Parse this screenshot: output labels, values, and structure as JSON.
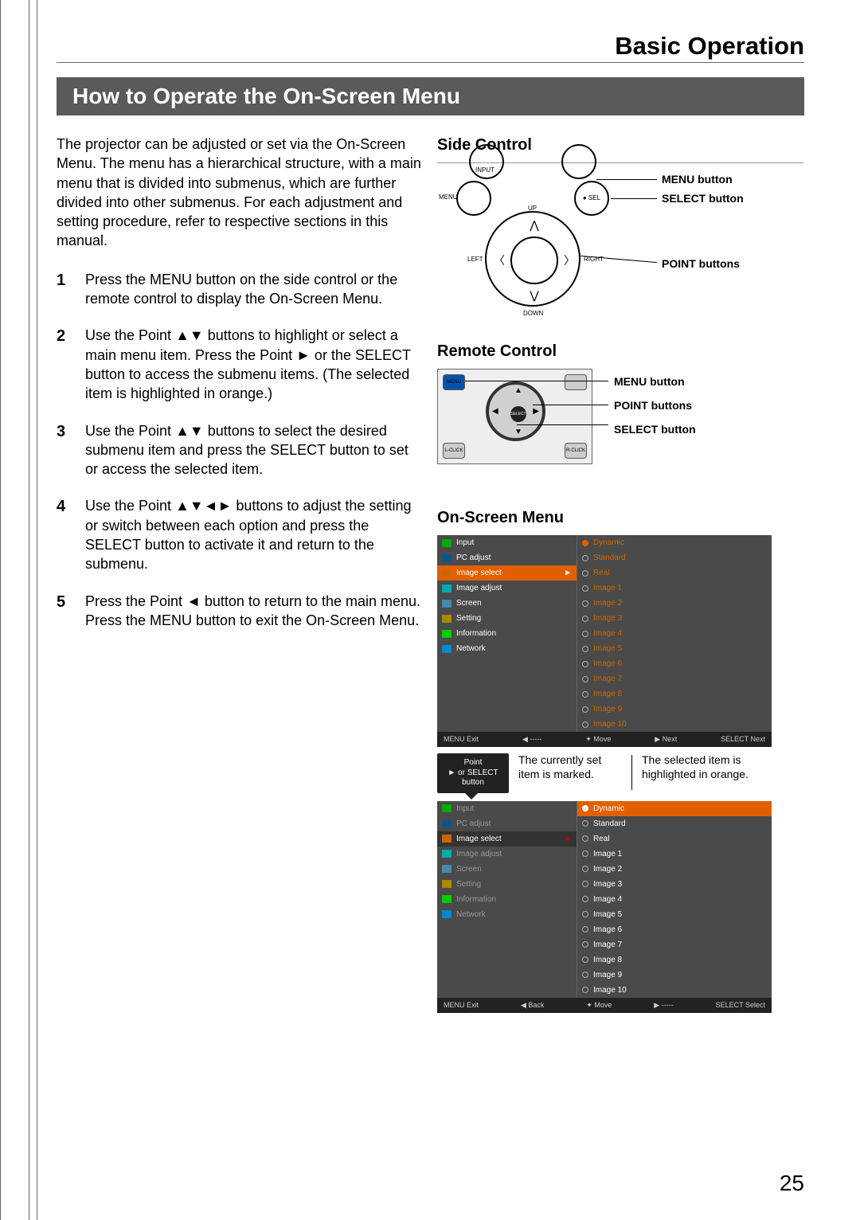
{
  "chapter": "Basic Operation",
  "title": "How to Operate the On-Screen Menu",
  "intro": "The projector can be adjusted or set via the On-Screen Menu. The menu has a hierarchical structure, with a main menu that is divided into submenus, which are further divided into other submenus. For each adjustment and setting procedure, refer to respective sections in this manual.",
  "steps": [
    "Press the MENU button on the side control or the remote control to display the On-Screen Menu.",
    "Use the Point ▲▼ buttons to highlight or select a main menu item. Press the Point ► or the SELECT button to access the submenu items. (The selected item is highlighted in orange.)",
    "Use the Point ▲▼ buttons to select the desired submenu item and press the SELECT button to set or access the selected item.",
    "Use the Point ▲▼◄► buttons to adjust the setting or switch between each option and press the SELECT button to activate it and return to the submenu.",
    "Press the Point ◄ button to return to the main menu. Press the MENU button to exit the On-Screen Menu."
  ],
  "side": {
    "heading": "Side Control",
    "input": "INPUT",
    "menu": "MENU",
    "sel": "● SEL",
    "up": "UP",
    "down": "DOWN",
    "left": "LEFT",
    "right": "RIGHT",
    "cb1": "MENU button",
    "cb2": "SELECT button",
    "cb3": "POINT buttons"
  },
  "remote": {
    "heading": "Remote Control",
    "menu": "MENU",
    "select": "SELECT",
    "lclick": "L-CLICK",
    "rclick": "R-CLICK",
    "cb1": "MENU button",
    "cb2": "POINT buttons",
    "cb3": "SELECT button"
  },
  "osm": {
    "heading": "On-Screen Menu",
    "left_items": [
      "Input",
      "PC adjust",
      "Image select",
      "Image adjust",
      "Screen",
      "Setting",
      "Information",
      "Network"
    ],
    "right_first": [
      "Dynamic",
      "Standard",
      "Real",
      "Image 1",
      "Image 2",
      "Image 3",
      "Image 4",
      "Image 5",
      "Image 6",
      "Image 7",
      "Image 8",
      "Image 9",
      "Image 10"
    ],
    "footer1": {
      "a": "MENU Exit",
      "b": "◀ -----",
      "c": "✦ Move",
      "d": "▶ Next",
      "e": "SELECT Next"
    },
    "point_tag": "Point\n► or SELECT\nbutton",
    "note1": "The currently set item is marked.",
    "note2": "The selected item is highlighted in orange.",
    "footer2": {
      "a": "MENU Exit",
      "b": "◀ Back",
      "c": "✦ Move",
      "d": "▶ -----",
      "e": "SELECT Select"
    }
  },
  "page_no": "25"
}
